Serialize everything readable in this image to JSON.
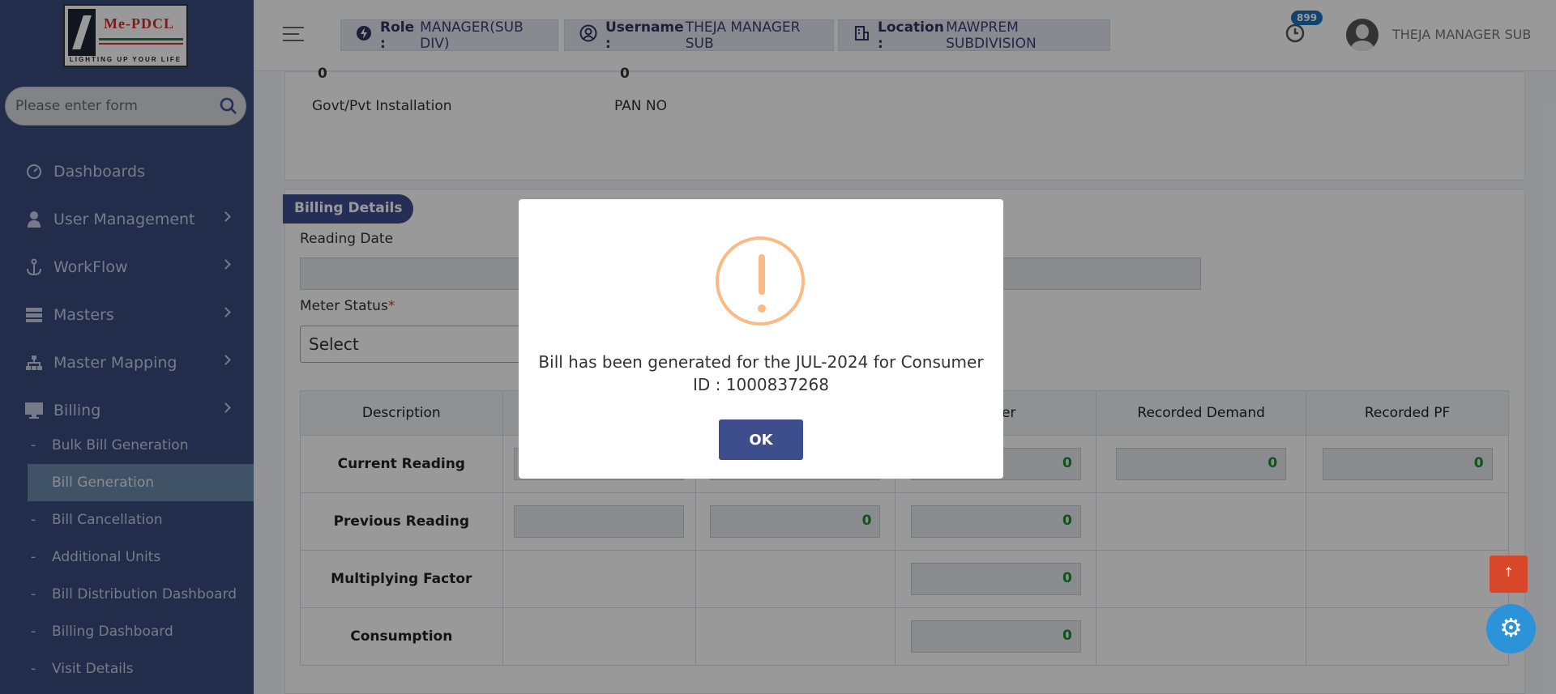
{
  "app": {
    "logo_name": "Me-PDCL",
    "logo_tagline": "LIGHTING UP YOUR LIFE"
  },
  "sidebar": {
    "search_placeholder": "Please enter form",
    "items": [
      {
        "label": "Dashboards",
        "icon": "dashboard-icon"
      },
      {
        "label": "User Management",
        "icon": "user-icon"
      },
      {
        "label": "WorkFlow",
        "icon": "anchor-icon"
      },
      {
        "label": "Masters",
        "icon": "server-icon"
      },
      {
        "label": "Master Mapping",
        "icon": "sitemap-icon"
      },
      {
        "label": "Billing",
        "icon": "monitor-icon"
      }
    ],
    "subitems": [
      "Bulk Bill Generation",
      "Bill Generation",
      "Bill Cancellation",
      "Additional Units",
      "Bill Distribution Dashboard",
      "Billing Dashboard",
      "Visit Details"
    ]
  },
  "header": {
    "role_label": "Role :",
    "role_value": "MANAGER(SUB DIV)",
    "username_label": "Username :",
    "username_value": "THEJA MANAGER SUB",
    "location_label": "Location :",
    "location_value": "MAWPREM SUBDIVISION",
    "notification_count": "899",
    "user_name": "THEJA MANAGER SUB"
  },
  "consumer": {
    "val1": "0",
    "val2": "0",
    "label1": "Govt/Pvt Installation",
    "label2": "PAN NO"
  },
  "billing": {
    "section_title": "Billing Details",
    "reading_date_label": "Reading Date",
    "meter_status_label": "Meter Status",
    "meter_status_req": "*",
    "meter_status_value": "Select",
    "columns": [
      "Description",
      "",
      "",
      "Meter",
      "Recorded Demand",
      "Recorded PF"
    ],
    "rows": [
      {
        "label": "Current Reading",
        "v3": "0",
        "v4": "0",
        "v5": "0"
      },
      {
        "label": "Previous Reading",
        "v2": "0",
        "v3": "0"
      },
      {
        "label": "Multiplying Factor",
        "v3": "0"
      },
      {
        "label": "Consumption",
        "v3": "0"
      }
    ]
  },
  "dialog": {
    "message": "Bill has been generated for the JUL-2024 for Consumer ID : 1000837268",
    "ok_label": "OK"
  },
  "colors": {
    "sidebar": "#3a4b7f",
    "accent": "#3e4e8c",
    "warning": "#f8bb86",
    "value": "#1a8a2c"
  }
}
